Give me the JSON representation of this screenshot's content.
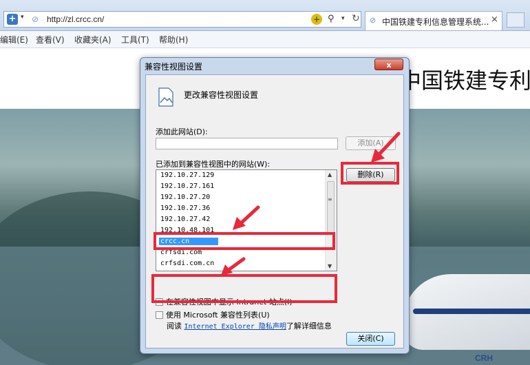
{
  "browser": {
    "url": "http://zl.crcc.cn/",
    "tab_title": "中国铁建专利信息管理系统...",
    "tab_close": "×"
  },
  "menu": [
    "编辑(E)",
    "查看(V)",
    "收藏夹(A)",
    "工具(T)",
    "帮助(H)"
  ],
  "page": {
    "site_title": "中国铁建专利",
    "banner_brand": "CRH"
  },
  "dialog": {
    "title": "兼容性视图设置",
    "close_label": "x",
    "header_label": "更改兼容性视图设置",
    "add_site_label": "添加此网站(D):",
    "add_site_value": "",
    "add_button": "添加(A)",
    "list_label": "已添加到兼容性视图中的网站(W):",
    "sites": [
      "192.10.27.129",
      "192.10.27.161",
      "192.10.27.20",
      "192.10.27.36",
      "192.10.27.42",
      "192.10.48.101",
      "crcc.cn",
      "crfsdi.com",
      "crfsdi.com.cn"
    ],
    "selected_site": "crcc.cn",
    "delete_button": "删除(R)",
    "option_intranet": "在兼容性视图中显示 Intranet 站点(I)",
    "option_intranet_checked": false,
    "option_mslist": "使用 Microsoft 兼容性列表(U)",
    "option_mslist_checked": false,
    "privacy_prefix": "阅读",
    "privacy_link": "Internet Explorer 隐私声明",
    "privacy_suffix": "了解详细信息",
    "close_button": "关闭(C)"
  },
  "colors": {
    "highlight_annotation": "#e8293a",
    "selection": "#3399ff"
  }
}
